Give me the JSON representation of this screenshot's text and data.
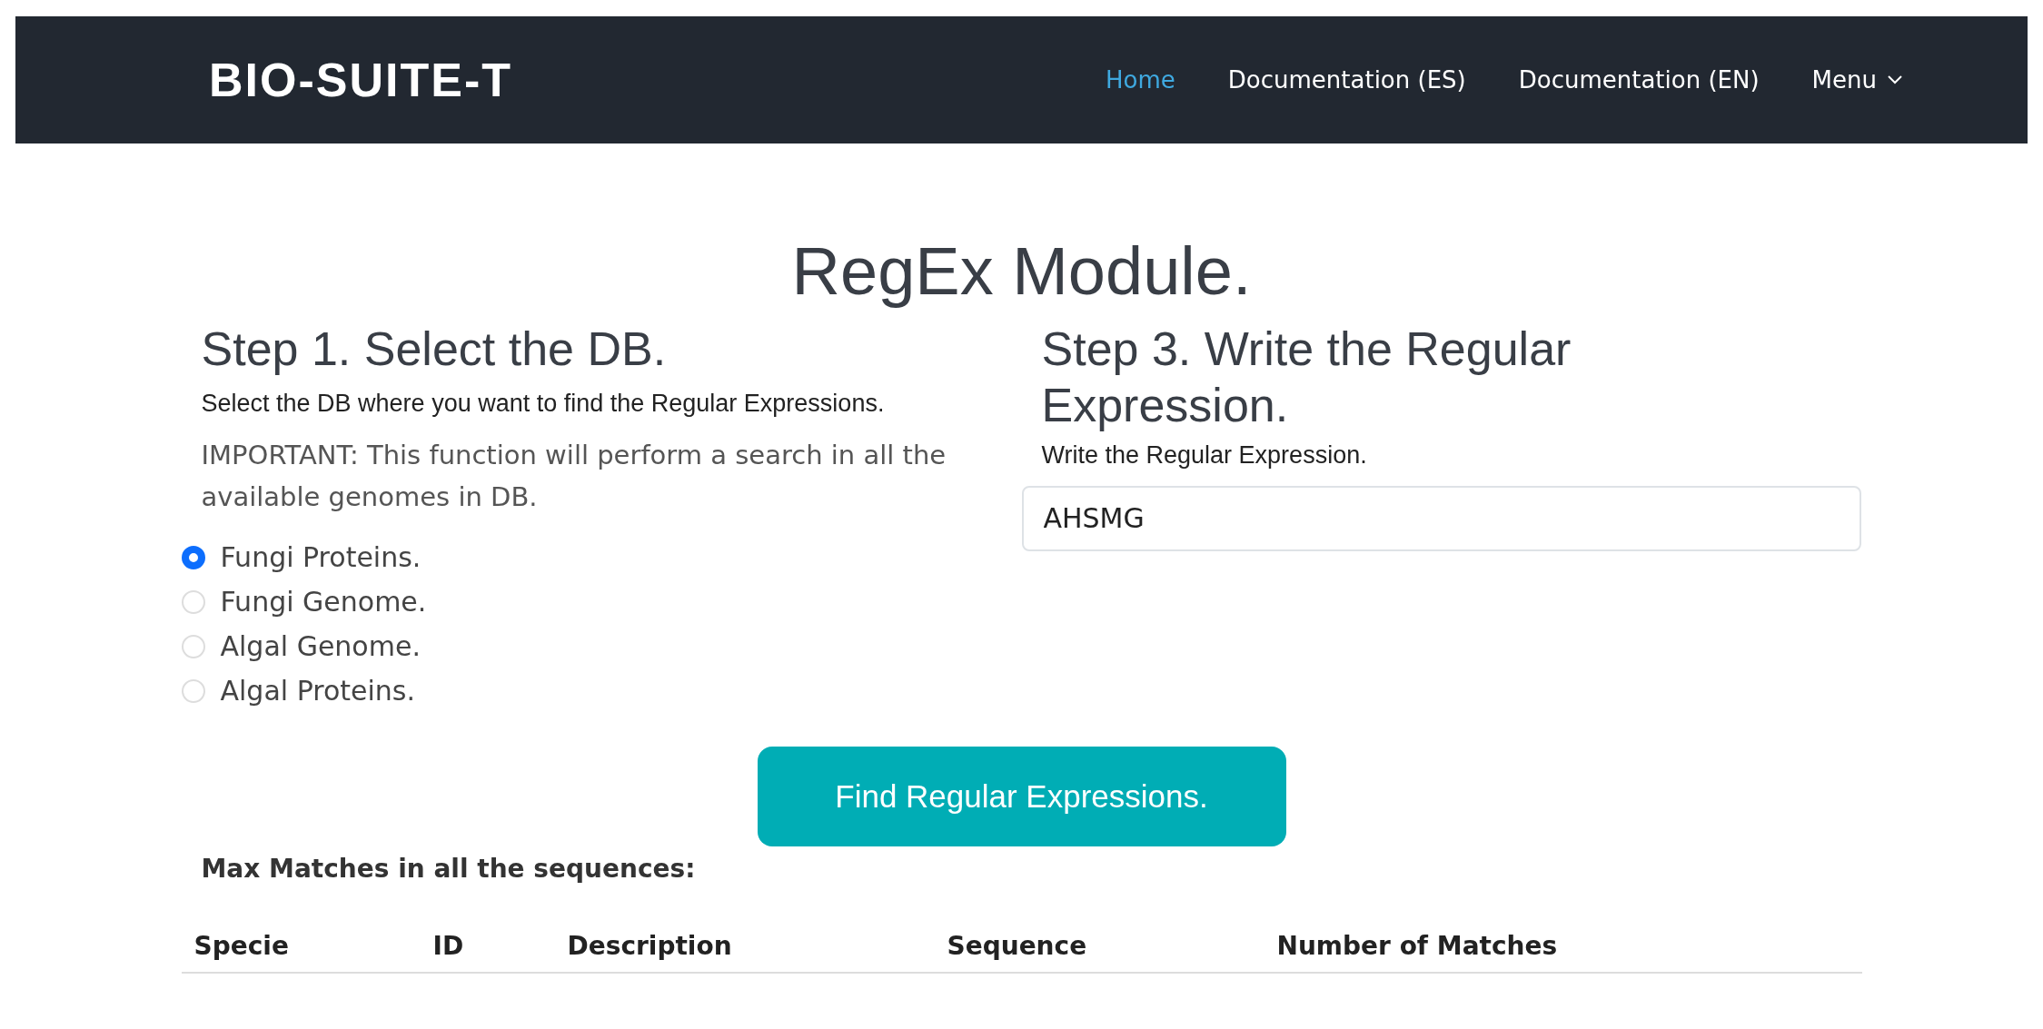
{
  "navbar": {
    "logo": "BIO-SUITE-T",
    "links": [
      {
        "label": "Home",
        "selected": true,
        "kind": "link"
      },
      {
        "label": "Documentation (ES)",
        "selected": false,
        "kind": "link"
      },
      {
        "label": "Documentation (EN)",
        "selected": false,
        "kind": "link"
      },
      {
        "label": "Menu",
        "selected": false,
        "kind": "dropdown"
      }
    ]
  },
  "title": "RegEx Module.",
  "step1": {
    "heading": "Step 1. Select the DB.",
    "subtitle": "Select the DB where you want to find the Regular Expressions.",
    "note": "IMPORTANT: This function will perform a search in all the available genomes in DB.",
    "options": [
      {
        "label": "Fungi Proteins.",
        "selected": true
      },
      {
        "label": "Fungi Genome.",
        "selected": false
      },
      {
        "label": "Algal Genome.",
        "selected": false
      },
      {
        "label": "Algal Proteins.",
        "selected": false
      }
    ]
  },
  "step3": {
    "heading": "Step 3. Write the Regular Expression.",
    "subtitle": "Write the Regular Expression.",
    "value": "AHSMG"
  },
  "button": "Find Regular Expressions.",
  "results_label": "Max Matches in all the sequences:",
  "table": {
    "columns": [
      "Specie",
      "ID",
      "Description",
      "Sequence",
      "Number of Matches"
    ]
  }
}
